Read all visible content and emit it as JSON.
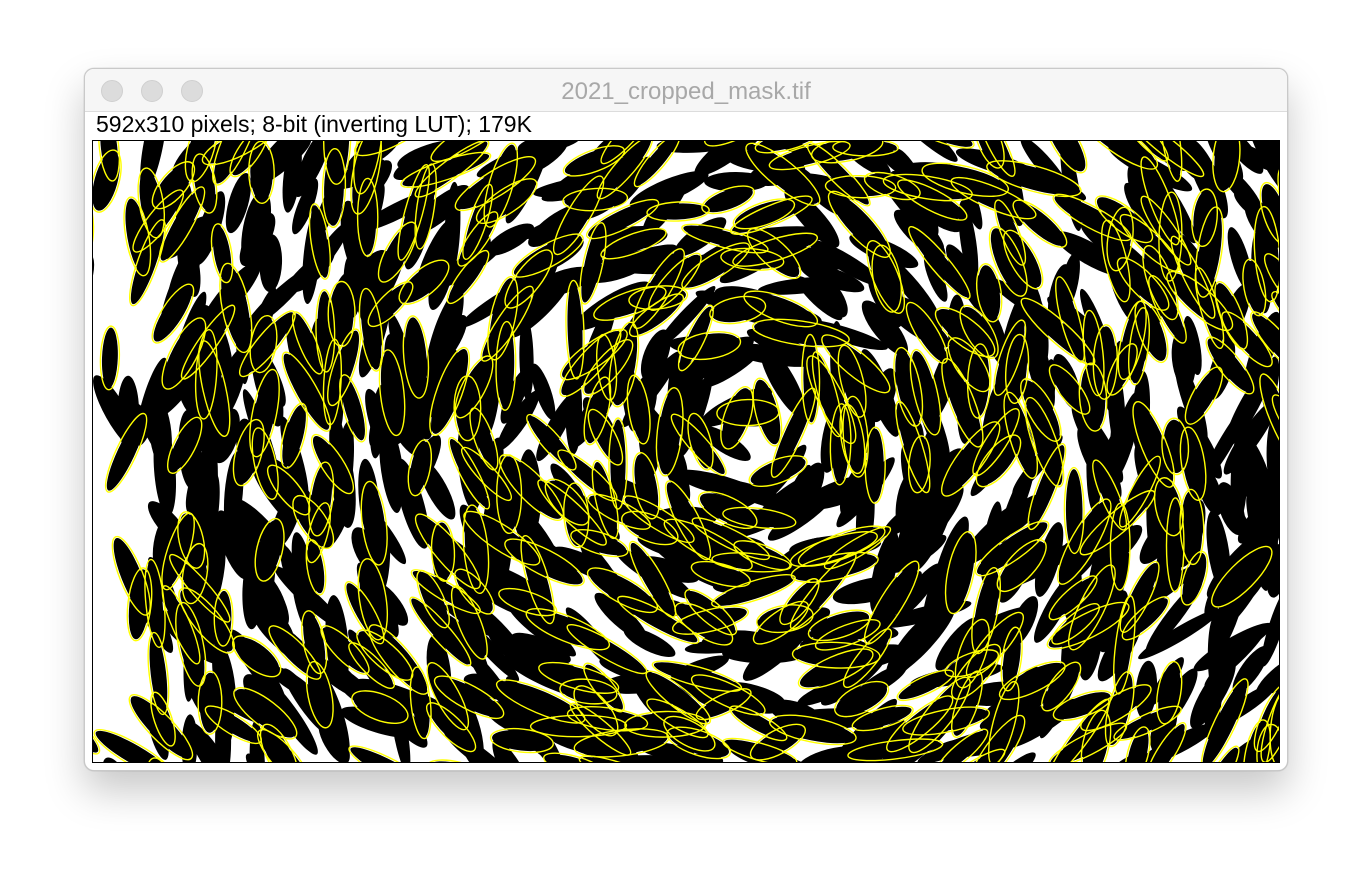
{
  "window": {
    "title": "2021_cropped_mask.tif",
    "traffic_lights": [
      "close",
      "minimize",
      "zoom"
    ]
  },
  "image_info": {
    "text": "592x310 pixels; 8-bit (inverting LUT); 179K"
  },
  "image_content": {
    "description_icon": "binary-mask-image",
    "colors": {
      "foreground": "#000000",
      "background": "#ffffff",
      "roi_outline": "#ffff00"
    }
  }
}
